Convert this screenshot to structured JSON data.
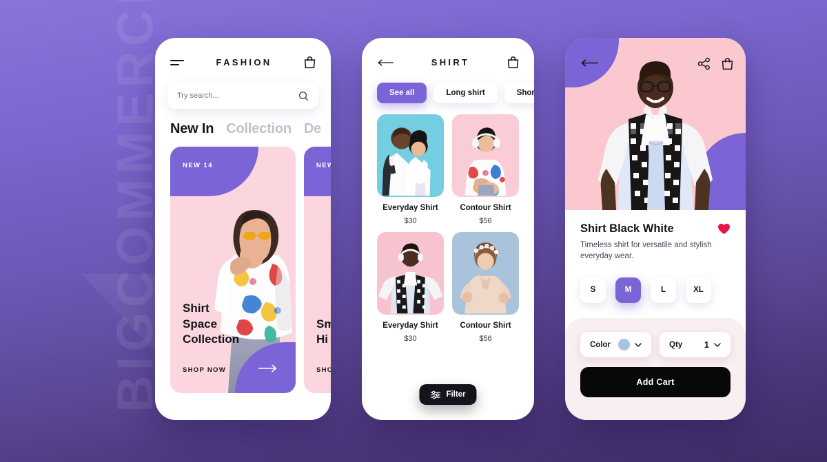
{
  "background": {
    "gradient_top": "#8a74d9",
    "gradient_bottom": "#3f2c66",
    "watermark": "BIGCOMMERCE"
  },
  "colors": {
    "accent_purple": "#7b64d6",
    "pink": "#fbd6de",
    "heart_red": "#e8174a",
    "dark": "#15131c",
    "swatch": "#a9c2de"
  },
  "phone1": {
    "header": {
      "title": "FASHION",
      "menu_icon": "hamburger-icon",
      "bag_icon": "shopping-bag-icon"
    },
    "search": {
      "placeholder": "Try search...",
      "value": "",
      "icon": "search-icon"
    },
    "tabs": [
      {
        "label": "New In",
        "active": true
      },
      {
        "label": "Collection",
        "active": false
      },
      {
        "label": "De",
        "active": false
      }
    ],
    "cards": [
      {
        "badge": "NEW 14",
        "title": "Shirt\nSpace\nCollection",
        "cta": "SHOP NOW",
        "arrow_icon": "arrow-right-icon"
      },
      {
        "badge": "NEW",
        "title": "Sm\nHi",
        "cta": "SHO",
        "arrow_icon": "arrow-right-icon"
      }
    ]
  },
  "phone2": {
    "header": {
      "title": "SHIRT",
      "back_icon": "arrow-left-icon",
      "bag_icon": "shopping-bag-icon"
    },
    "chips": [
      {
        "label": "See all",
        "active": true
      },
      {
        "label": "Long shirt",
        "active": false
      },
      {
        "label": "Short shirt",
        "active": false
      }
    ],
    "products": [
      {
        "name": "Everyday Shirt",
        "price": "$30",
        "bg": "#74cde0"
      },
      {
        "name": "Contour Shirt",
        "price": "$56",
        "bg": "#f9ccd6"
      },
      {
        "name": "Everyday Shirt",
        "price": "$30",
        "bg": "#f6c3cf"
      },
      {
        "name": "Contour Shirt",
        "price": "$56",
        "bg": "#a9c3dc"
      }
    ],
    "filter": {
      "label": "Filter",
      "icon": "sliders-icon"
    }
  },
  "phone3": {
    "header": {
      "back_icon": "arrow-left-icon",
      "share_icon": "share-icon",
      "bag_icon": "shopping-bag-icon"
    },
    "product": {
      "name": "Shirt Black White",
      "description": "Timeless shirt for versatile and stylish everyday wear.",
      "favorite_icon": "heart-icon"
    },
    "sizes": [
      {
        "label": "S",
        "active": false
      },
      {
        "label": "M",
        "active": true
      },
      {
        "label": "L",
        "active": false
      },
      {
        "label": "XL",
        "active": false
      }
    ],
    "color_select": {
      "label": "Color",
      "value_swatch": "#a9c2de",
      "chevron": "chevron-down-icon"
    },
    "qty_select": {
      "label": "Qty",
      "value": "1",
      "chevron": "chevron-down-icon"
    },
    "add_cart": {
      "label": "Add Cart"
    }
  }
}
